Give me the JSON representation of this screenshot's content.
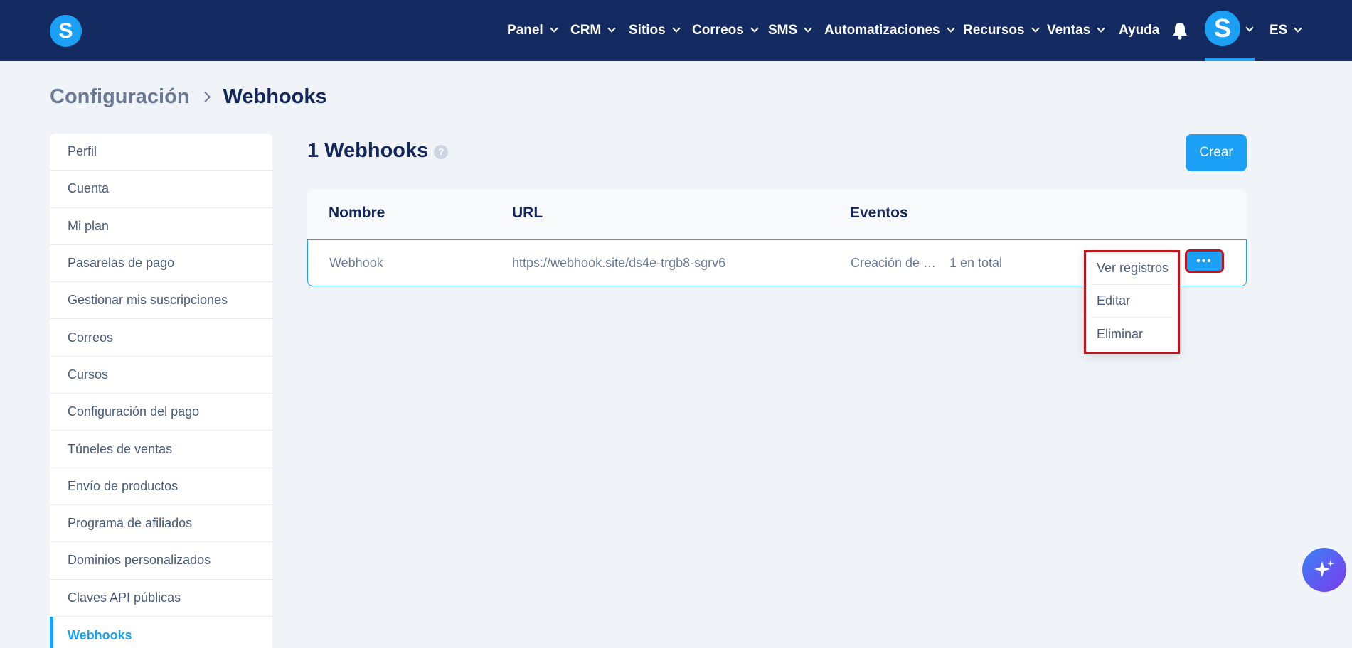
{
  "brand": {
    "logo_letter": "S",
    "accent": "#1ba0f5",
    "nav_bg": "#142b62"
  },
  "nav": {
    "items": [
      {
        "label": "Panel",
        "has_dropdown": true
      },
      {
        "label": "CRM",
        "has_dropdown": true
      },
      {
        "label": "Sitios",
        "has_dropdown": true
      },
      {
        "label": "Correos",
        "has_dropdown": true
      },
      {
        "label": "SMS",
        "has_dropdown": true
      },
      {
        "label": "Automatizaciones",
        "has_dropdown": true
      },
      {
        "label": "Recursos",
        "has_dropdown": true
      },
      {
        "label": "Ventas",
        "has_dropdown": true
      },
      {
        "label": "Ayuda",
        "has_dropdown": false
      }
    ],
    "bell_icon": "bell-icon",
    "avatar_letter": "S",
    "language": "ES"
  },
  "breadcrumb": {
    "parent": "Configuración",
    "current": "Webhooks"
  },
  "sidebar": {
    "items": [
      {
        "label": "Perfil",
        "active": false
      },
      {
        "label": "Cuenta",
        "active": false
      },
      {
        "label": "Mi plan",
        "active": false
      },
      {
        "label": "Pasarelas de pago",
        "active": false
      },
      {
        "label": "Gestionar mis suscripciones",
        "active": false
      },
      {
        "label": "Correos",
        "active": false
      },
      {
        "label": "Cursos",
        "active": false
      },
      {
        "label": "Configuración del pago",
        "active": false
      },
      {
        "label": "Túneles de ventas",
        "active": false
      },
      {
        "label": "Envío de productos",
        "active": false
      },
      {
        "label": "Programa de afiliados",
        "active": false
      },
      {
        "label": "Dominios personalizados",
        "active": false
      },
      {
        "label": "Claves API públicas",
        "active": false
      },
      {
        "label": "Webhooks",
        "active": true
      }
    ]
  },
  "main": {
    "title": "1 Webhooks",
    "help_icon": "?",
    "create_label": "Crear",
    "table": {
      "headers": [
        "Nombre",
        "URL",
        "Eventos"
      ],
      "rows": [
        {
          "name": "Webhook",
          "url": "https://webhook.site/ds4e-trgb8-sgrv6",
          "events": "Creación de …",
          "events_count": "1 en total",
          "actions_label": "•••"
        }
      ]
    },
    "row_menu": {
      "items": [
        "Ver registros",
        "Editar",
        "Eliminar"
      ]
    }
  }
}
